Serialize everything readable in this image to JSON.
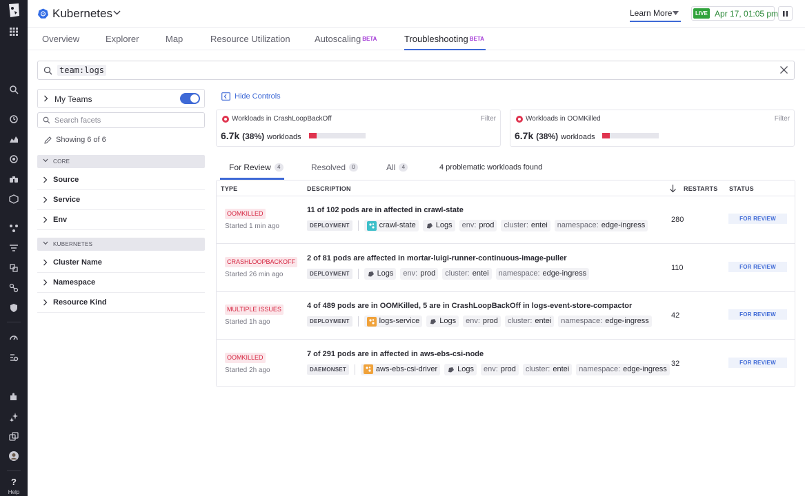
{
  "app": {
    "title": "Kubernetes"
  },
  "header": {
    "learn_more": "Learn More",
    "live_badge": "LIVE",
    "timestamp": "Apr 17, 01:05 pm"
  },
  "rail": {
    "help_label": "Help"
  },
  "tabs": [
    {
      "label": "Overview",
      "beta": ""
    },
    {
      "label": "Explorer",
      "beta": ""
    },
    {
      "label": "Map",
      "beta": ""
    },
    {
      "label": "Resource Utilization",
      "beta": ""
    },
    {
      "label": "Autoscaling",
      "beta": "BETA"
    },
    {
      "label": "Troubleshooting",
      "beta": "BETA"
    }
  ],
  "search": {
    "query": "team:logs"
  },
  "facets": {
    "my_teams": "My Teams",
    "my_teams_enabled": true,
    "search_placeholder": "Search facets",
    "showing": "Showing 6 of 6",
    "groups": [
      {
        "name": "CORE",
        "items": [
          "Source",
          "Service",
          "Env"
        ]
      },
      {
        "name": "KUBERNETES",
        "items": [
          "Cluster Name",
          "Namespace",
          "Resource Kind"
        ]
      }
    ]
  },
  "controls": {
    "hide_label": "Hide Controls"
  },
  "cards": [
    {
      "title": "Workloads in CrashLoopBackOff",
      "filter": "Filter",
      "value": "6.7k",
      "percent": "(38%)",
      "unit": "workloads",
      "fraction": 0.13
    },
    {
      "title": "Workloads in OOMKilled",
      "filter": "Filter",
      "value": "6.7k",
      "percent": "(38%)",
      "unit": "workloads",
      "fraction": 0.13
    }
  ],
  "review_tabs": [
    {
      "label": "For Review",
      "count": "4"
    },
    {
      "label": "Resolved",
      "count": "0"
    },
    {
      "label": "All",
      "count": "4"
    }
  ],
  "problem_count": "4 problematic workloads found",
  "table": {
    "headers": {
      "type": "TYPE",
      "description": "DESCRIPTION",
      "restarts": "RESTARTS",
      "status": "STATUS"
    },
    "rows": [
      {
        "type": "OOMKILLED",
        "started": "Started 1 min ago",
        "description": "11 of 102 pods are in affected in crawl-state",
        "kind": "DEPLOYMENT",
        "service": "crawl-state",
        "service_color": "#3dbfc9",
        "logs": "Logs",
        "env": "prod",
        "cluster": "entei",
        "namespace": "edge-ingress",
        "restarts": "280",
        "status": "FOR REVIEW"
      },
      {
        "type": "CRASHLOOPBACKOFF",
        "started": "Started 26 min ago",
        "description": "2 of 81 pods are affected in mortar-luigi-runner-continuous-image-puller",
        "kind": "DEPLOYMENT",
        "service": "",
        "service_color": "",
        "logs": "Logs",
        "env": "prod",
        "cluster": "entei",
        "namespace": "edge-ingress",
        "restarts": "110",
        "status": "FOR REVIEW"
      },
      {
        "type": "MULTIPLE ISSUES",
        "started": "Started 1h ago",
        "description": "4 of 489 pods are in OOMKilled, 5 are in CrashLoopBackOff in logs-event-store-compactor",
        "kind": "DEPLOYMENT",
        "service": "logs-service",
        "service_color": "#f0a23a",
        "logs": "Logs",
        "env": "prod",
        "cluster": "entei",
        "namespace": "edge-ingress",
        "restarts": "42",
        "status": "FOR REVIEW"
      },
      {
        "type": "OOMKILLED",
        "started": "Started 2h ago",
        "description": "7 of 291 pods are in affected in aws-ebs-csi-node",
        "kind": "DAEMONSET",
        "service": "aws-ebs-csi-driver",
        "service_color": "#f0a23a",
        "logs": "Logs",
        "env": "prod",
        "cluster": "entei",
        "namespace": "edge-ingress",
        "restarts": "32",
        "status": "FOR REVIEW"
      }
    ],
    "tag_keys": {
      "env": "env:",
      "cluster": "cluster:",
      "namespace": "namespace:"
    }
  }
}
